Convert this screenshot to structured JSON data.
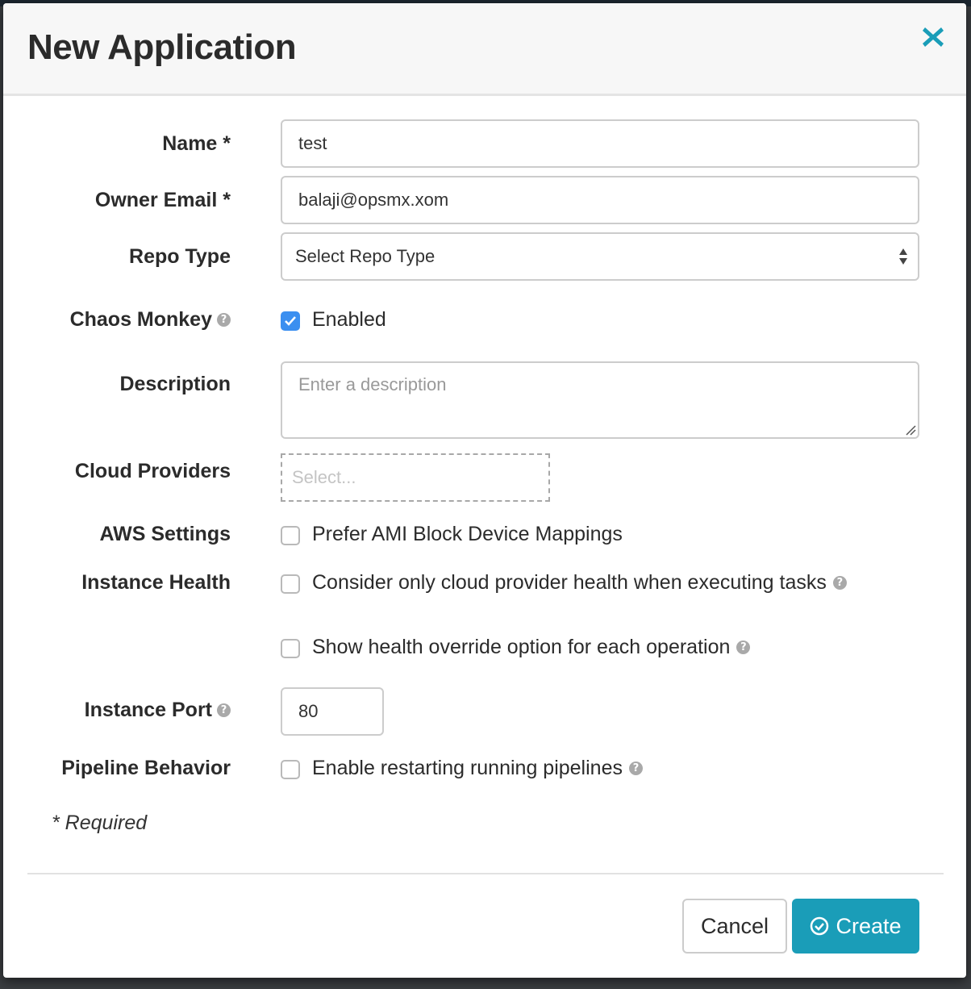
{
  "dialog": {
    "title": "New Application",
    "close_icon": "close-icon"
  },
  "form": {
    "name": {
      "label": "Name *",
      "value": "test"
    },
    "owner_email": {
      "label": "Owner Email *",
      "value": "balaji@opsmx.xom"
    },
    "repo_type": {
      "label": "Repo Type",
      "selected": "Select Repo Type"
    },
    "chaos_monkey": {
      "label": "Chaos Monkey",
      "checkbox_label": "Enabled",
      "checked": true
    },
    "description": {
      "label": "Description",
      "placeholder": "Enter a description",
      "value": ""
    },
    "cloud_providers": {
      "label": "Cloud Providers",
      "placeholder": "Select..."
    },
    "aws_settings": {
      "label": "AWS Settings",
      "checkbox_label": "Prefer AMI Block Device Mappings",
      "checked": false
    },
    "instance_health": {
      "label": "Instance Health",
      "options": [
        {
          "checkbox_label": "Consider only cloud provider health when executing tasks",
          "checked": false,
          "help": true
        },
        {
          "checkbox_label": "Show health override option for each operation",
          "checked": false,
          "help": true
        }
      ]
    },
    "instance_port": {
      "label": "Instance Port",
      "value": "80"
    },
    "pipeline_behavior": {
      "label": "Pipeline Behavior",
      "checkbox_label": "Enable restarting running pipelines",
      "checked": false
    },
    "required_note": "* Required"
  },
  "footer": {
    "cancel_label": "Cancel",
    "create_label": "Create"
  },
  "colors": {
    "accent": "#1a9db8",
    "checkbox_checked": "#3b8ff0"
  }
}
